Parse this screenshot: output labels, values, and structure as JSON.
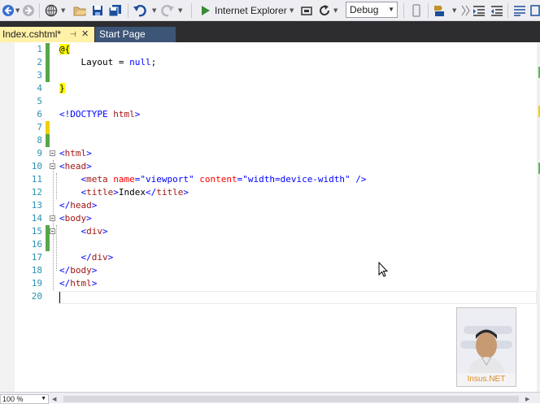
{
  "toolbar": {
    "browser_label": "Internet Explorer",
    "config_value": "Debug"
  },
  "tabs": [
    {
      "label": "Index.cshtml*",
      "pin": "⊣",
      "close": "✕"
    },
    {
      "label": "Start Page"
    }
  ],
  "editor": {
    "lines": [
      {
        "num": "1"
      },
      {
        "num": "2"
      },
      {
        "num": "3"
      },
      {
        "num": "4"
      },
      {
        "num": "5"
      },
      {
        "num": "6"
      },
      {
        "num": "7"
      },
      {
        "num": "8"
      },
      {
        "num": "9"
      },
      {
        "num": "10"
      },
      {
        "num": "11"
      },
      {
        "num": "12"
      },
      {
        "num": "13"
      },
      {
        "num": "14"
      },
      {
        "num": "15"
      },
      {
        "num": "16"
      },
      {
        "num": "17"
      },
      {
        "num": "18"
      },
      {
        "num": "19"
      },
      {
        "num": "20"
      }
    ],
    "code": {
      "l1_a": "@{",
      "l2_a": "    Layout = ",
      "l2_b": "null",
      "l2_c": ";",
      "l4_a": "}",
      "l6_a": "<!DOCTYPE ",
      "l6_b": "html",
      "l6_c": ">",
      "l9_a": "<",
      "l9_b": "html",
      "l9_c": ">",
      "l10_a": "<",
      "l10_b": "head",
      "l10_c": ">",
      "l11_a": "    <",
      "l11_b": "meta",
      "l11_c": " name",
      "l11_d": "=",
      "l11_e": "\"viewport\"",
      "l11_f": " content",
      "l11_g": "=",
      "l11_h": "\"width=device-width\"",
      "l11_i": " />",
      "l12_a": "    <",
      "l12_b": "title",
      "l12_c": ">",
      "l12_d": "Index",
      "l12_e": "</",
      "l12_f": "title",
      "l12_g": ">",
      "l13_a": "</",
      "l13_b": "head",
      "l13_c": ">",
      "l14_a": "<",
      "l14_b": "body",
      "l14_c": ">",
      "l15_a": "    <",
      "l15_b": "div",
      "l15_c": ">",
      "l17_a": "    </",
      "l17_b": "div",
      "l17_c": ">",
      "l18_a": "</",
      "l18_b": "body",
      "l18_c": ">",
      "l19_a": "</",
      "l19_b": "html",
      "l19_c": ">"
    }
  },
  "watermark": {
    "caption": "Insus.NET"
  },
  "statusbar": {
    "zoom": "100 %"
  },
  "colors": {
    "change_saved": "#57a64a",
    "change_unsaved": "#f0d000",
    "line_number": "#2b91af",
    "tab_active": "#fff1a8",
    "tab_inactive": "#3d5577",
    "tabstrip_bg": "#2d2d30"
  },
  "icons": [
    "back-icon",
    "forward-icon",
    "web-icon",
    "open-folder-icon",
    "save-icon",
    "save-all-icon",
    "undo-icon",
    "redo-icon",
    "play-icon",
    "browser-link-icon",
    "refresh-icon",
    "device-icon",
    "bookmark-icon",
    "comment-icon",
    "indent-icon"
  ]
}
